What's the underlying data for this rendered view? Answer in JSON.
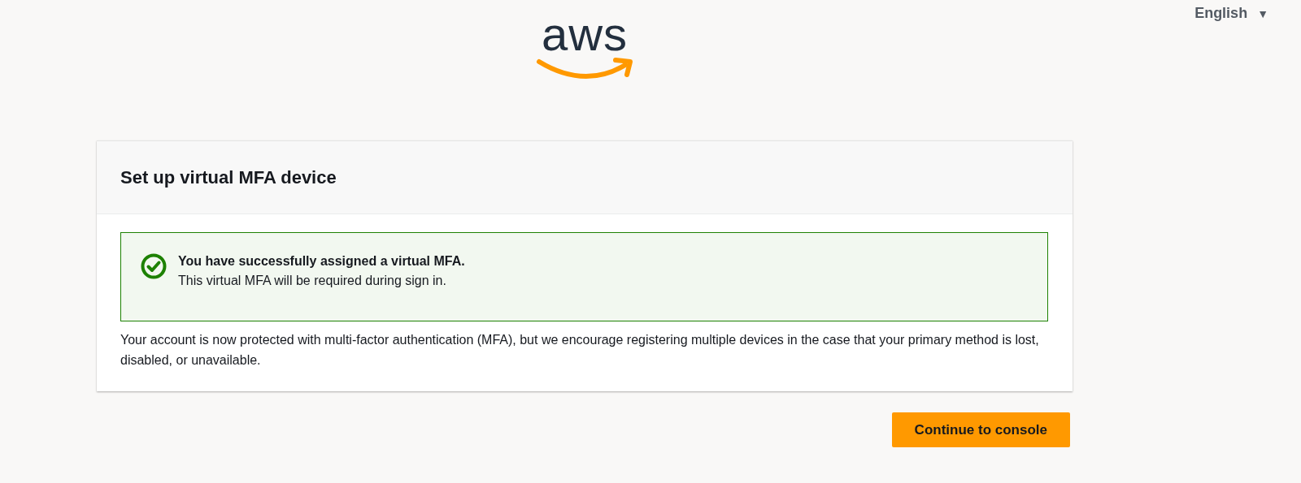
{
  "header": {
    "logo": "aws",
    "language": {
      "label": "English",
      "caret": "▼"
    }
  },
  "card": {
    "title": "Set up virtual MFA device",
    "alert": {
      "kind": "success",
      "title": "You have successfully assigned a virtual MFA.",
      "message": "This virtual MFA will be required during sign in."
    },
    "body": "Your account is now protected with multi-factor authentication (MFA), but we encourage registering multiple devices in the case that your primary method is lost, disabled, or unavailable."
  },
  "buttons": [
    {
      "label": "Continue to console",
      "kind": "primary"
    }
  ]
}
